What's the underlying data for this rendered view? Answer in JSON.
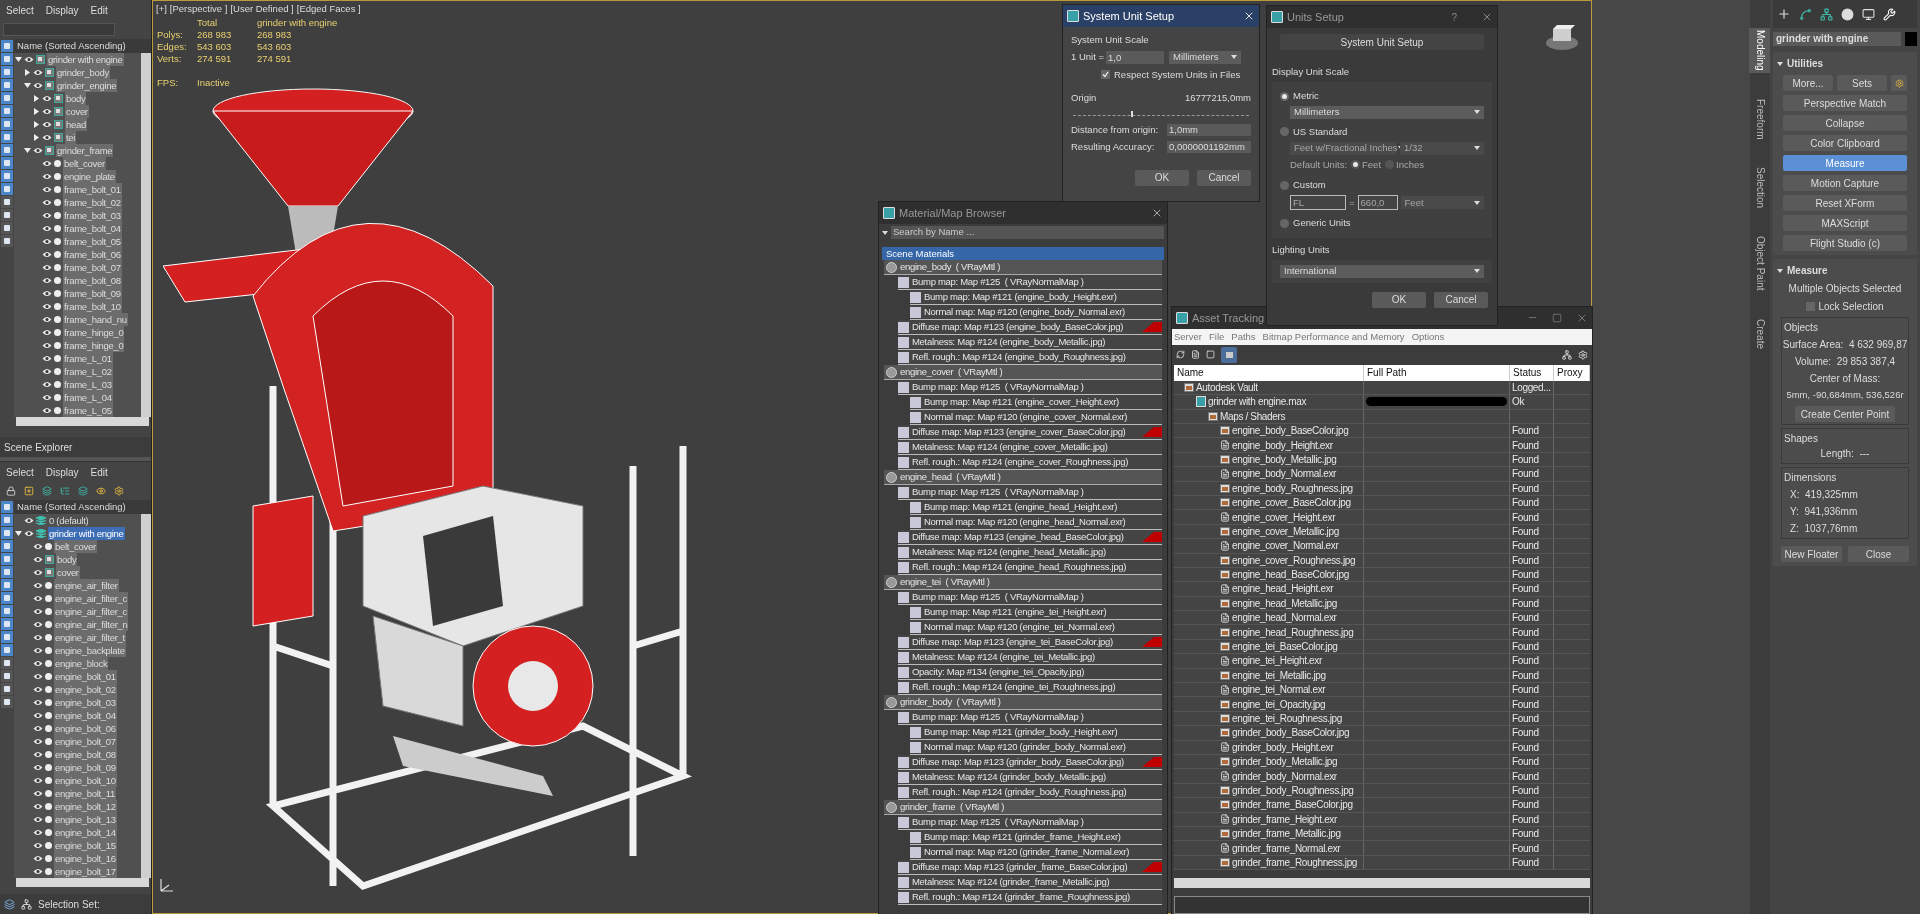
{
  "explorer_top": {
    "menu": [
      "Select",
      "Display",
      "Edit"
    ],
    "column": "Name (Sorted Ascending)",
    "footer": "Scene Explorer",
    "tree": [
      {
        "name": "grinder with engine",
        "kind": "group",
        "expanded": true,
        "children": [
          {
            "name": "grinder_body",
            "kind": "group",
            "expanded": false
          },
          {
            "name": "grinder_engine",
            "kind": "group",
            "expanded": true,
            "children": [
              {
                "name": "body",
                "kind": "group",
                "expanded": false
              },
              {
                "name": "cover",
                "kind": "group",
                "expanded": false
              },
              {
                "name": "head",
                "kind": "group",
                "expanded": false
              },
              {
                "name": "tei",
                "kind": "group",
                "expanded": false
              }
            ]
          },
          {
            "name": "grinder_frame",
            "kind": "group",
            "expanded": true,
            "children": [
              {
                "name": "belt_cover",
                "kind": "object"
              },
              {
                "name": "engine_plate",
                "kind": "object"
              },
              {
                "name": "frame_bolt_01",
                "kind": "object"
              },
              {
                "name": "frame_bolt_02",
                "kind": "object"
              },
              {
                "name": "frame_bolt_03",
                "kind": "object"
              },
              {
                "name": "frame_bolt_04",
                "kind": "object"
              },
              {
                "name": "frame_bolt_05",
                "kind": "object"
              },
              {
                "name": "frame_bolt_06",
                "kind": "object"
              },
              {
                "name": "frame_bolt_07",
                "kind": "object"
              },
              {
                "name": "frame_bolt_08",
                "kind": "object"
              },
              {
                "name": "frame_bolt_09",
                "kind": "object"
              },
              {
                "name": "frame_bolt_10",
                "kind": "object"
              },
              {
                "name": "frame_hand_nu",
                "kind": "object"
              },
              {
                "name": "frame_hinge_0",
                "kind": "object"
              },
              {
                "name": "frame_hinge_0",
                "kind": "object"
              },
              {
                "name": "frame_L_01",
                "kind": "object"
              },
              {
                "name": "frame_L_02",
                "kind": "object"
              },
              {
                "name": "frame_L_03",
                "kind": "object"
              },
              {
                "name": "frame_L_04",
                "kind": "object"
              },
              {
                "name": "frame_L_05",
                "kind": "object"
              }
            ]
          }
        ]
      }
    ]
  },
  "explorer_bottom": {
    "menu": [
      "Select",
      "Display",
      "Edit"
    ],
    "column": "Name (Sorted Ascending)",
    "footer": "Selection Set:",
    "tree": [
      {
        "name": "0 (default)",
        "kind": "layer",
        "selected": false
      },
      {
        "name": "grinder with engine",
        "kind": "layer",
        "expanded": true,
        "selected": true,
        "children": [
          {
            "name": "belt_cover",
            "kind": "object"
          },
          {
            "name": "body",
            "kind": "group"
          },
          {
            "name": "cover",
            "kind": "group"
          },
          {
            "name": "engine_air_filter",
            "kind": "object"
          },
          {
            "name": "engine_air_filter_c",
            "kind": "object"
          },
          {
            "name": "engine_air_filter_c",
            "kind": "object"
          },
          {
            "name": "engine_air_filter_n",
            "kind": "object"
          },
          {
            "name": "engine_air_filter_t",
            "kind": "object"
          },
          {
            "name": "engine_backplate",
            "kind": "object"
          },
          {
            "name": "engine_block",
            "kind": "object"
          },
          {
            "name": "engine_bolt_01",
            "kind": "object"
          },
          {
            "name": "engine_bolt_02",
            "kind": "object"
          },
          {
            "name": "engine_bolt_03",
            "kind": "object"
          },
          {
            "name": "engine_bolt_04",
            "kind": "object"
          },
          {
            "name": "engine_bolt_06",
            "kind": "object"
          },
          {
            "name": "engine_bolt_07",
            "kind": "object"
          },
          {
            "name": "engine_bolt_08",
            "kind": "object"
          },
          {
            "name": "engine_bolt_09",
            "kind": "object"
          },
          {
            "name": "engine_bolt_10",
            "kind": "object"
          },
          {
            "name": "engine_bolt_11",
            "kind": "object"
          },
          {
            "name": "engine_bolt_12",
            "kind": "object"
          },
          {
            "name": "engine_bolt_13",
            "kind": "object"
          },
          {
            "name": "engine_bolt_14",
            "kind": "object"
          },
          {
            "name": "engine_bolt_15",
            "kind": "object"
          },
          {
            "name": "engine_bolt_16",
            "kind": "object"
          },
          {
            "name": "engine_bolt_17",
            "kind": "object"
          }
        ]
      }
    ]
  },
  "viewport": {
    "labels": [
      "[+]",
      "[Perspective ]",
      "[User Defined ]",
      "[Edged Faces ]"
    ],
    "stats": {
      "headers": [
        "Total",
        "grinder with engine"
      ],
      "rows": [
        {
          "label": "Polys:",
          "values": [
            "268 983",
            "268 983"
          ]
        },
        {
          "label": "Edges:",
          "values": [
            "543 603",
            "543 603"
          ]
        },
        {
          "label": "Verts:",
          "values": [
            "274 591",
            "274 591"
          ]
        }
      ]
    },
    "fps": {
      "label": "FPS:",
      "value": "Inactive"
    }
  },
  "system_unit_setup": {
    "title": "System Unit Setup",
    "scale_heading": "System Unit Scale",
    "unit_label": "1 Unit =",
    "unit_value": "1,0",
    "unit": "Millimeters",
    "respect": {
      "label": "Respect System Units in Files",
      "checked": true
    },
    "origin_label": "Origin",
    "origin_value": "16777215,0mm",
    "origin": {
      "level": 0.33
    },
    "distance_label": "Distance from origin:",
    "distance": "1,0mm",
    "accuracy_label": "Resulting Accuracy:",
    "accuracy": "0,0000001192mm",
    "buttons": [
      "OK",
      "Cancel"
    ]
  },
  "units_setup": {
    "title": "Units Setup",
    "help": "?",
    "system_button": "System Unit Setup",
    "display_heading": "Display Unit Scale",
    "options": [
      {
        "kind": "metric",
        "label": "Metric",
        "selected": true,
        "dropdown": "Millimeters"
      },
      {
        "kind": "us",
        "label": "US Standard",
        "selected": false,
        "dropdowns": [
          "Feet w/Fractional Inches",
          "1/32"
        ],
        "default_label": "Default Units:",
        "defaults": [
          {
            "label": "Feet",
            "selected": true
          },
          {
            "label": "Inches",
            "selected": false
          }
        ]
      },
      {
        "kind": "custom",
        "label": "Custom",
        "selected": false,
        "field": "FL",
        "equals": "=",
        "value": "660,0",
        "unit": "Feet"
      },
      {
        "kind": "generic",
        "label": "Generic Units",
        "selected": false
      }
    ],
    "lighting_heading": "Lighting Units",
    "lighting": "International",
    "buttons": [
      "OK",
      "Cancel"
    ]
  },
  "material_browser": {
    "title": "Material/Map Browser",
    "search_placeholder": "Search by Name ...",
    "group": "Scene Materials",
    "materials": [
      {
        "label": "engine_body  ( VRayMtl )",
        "maps": [
          {
            "label": "Bump map: Map #125  ( VRayNormalMap )",
            "flag": false,
            "children": [
              {
                "label": "Bump map: Map #121 (engine_body_Height.exr)"
              },
              {
                "label": "Normal map: Map #120 (engine_body_Normal.exr)"
              }
            ]
          },
          {
            "label": "Diffuse map: Map #123 (engine_body_BaseColor.jpg)",
            "flag": true
          },
          {
            "label": "Metalness: Map #124 (engine_body_Metallic.jpg)",
            "flag": false
          },
          {
            "label": "Refl. rough.: Map #124 (engine_body_Roughness.jpg)",
            "flag": false
          }
        ]
      },
      {
        "label": "engine_cover  ( VRayMtl )",
        "maps": [
          {
            "label": "Bump map: Map #125  ( VRayNormalMap )",
            "flag": false,
            "children": [
              {
                "label": "Bump map: Map #121 (engine_cover_Height.exr)"
              },
              {
                "label": "Normal map: Map #120 (engine_cover_Normal.exr)"
              }
            ]
          },
          {
            "label": "Diffuse map: Map #123 (engine_cover_BaseColor.jpg)",
            "flag": true
          },
          {
            "label": "Metalness: Map #124 (engine_cover_Metallic.jpg)",
            "flag": false
          },
          {
            "label": "Refl. rough.: Map #124 (engine_cover_Roughness.jpg)",
            "flag": false
          }
        ]
      },
      {
        "label": "engine_head  ( VRayMtl )",
        "maps": [
          {
            "label": "Bump map: Map #125  ( VRayNormalMap )",
            "flag": false,
            "children": [
              {
                "label": "Bump map: Map #121 (engine_head_Height.exr)"
              },
              {
                "label": "Normal map: Map #120 (engine_head_Normal.exr)"
              }
            ]
          },
          {
            "label": "Diffuse map: Map #123 (engine_head_BaseColor.jpg)",
            "flag": true
          },
          {
            "label": "Metalness: Map #124 (engine_head_Metallic.jpg)",
            "flag": false
          },
          {
            "label": "Refl. rough.: Map #124 (engine_head_Roughness.jpg)",
            "flag": false
          }
        ]
      },
      {
        "label": "engine_tei  ( VRayMtl )",
        "maps": [
          {
            "label": "Bump map: Map #125  ( VRayNormalMap )",
            "flag": false,
            "children": [
              {
                "label": "Bump map: Map #121 (engine_tei_Height.exr)"
              },
              {
                "label": "Normal map: Map #120 (engine_tei_Normal.exr)"
              }
            ]
          },
          {
            "label": "Diffuse map: Map #123 (engine_tei_BaseColor.jpg)",
            "flag": true
          },
          {
            "label": "Metalness: Map #124 (engine_tei_Metallic.jpg)",
            "flag": false
          },
          {
            "label": "Opacity: Map #134 (engine_tei_Opacity.jpg)",
            "flag": false
          },
          {
            "label": "Refl. rough.: Map #124 (engine_tei_Roughness.jpg)",
            "flag": false
          }
        ]
      },
      {
        "label": "grinder_body  ( VRayMtl )",
        "maps": [
          {
            "label": "Bump map: Map #125  ( VRayNormalMap )",
            "flag": false,
            "children": [
              {
                "label": "Bump map: Map #121 (grinder_body_Height.exr)"
              },
              {
                "label": "Normal map: Map #120 (grinder_body_Normal.exr)"
              }
            ]
          },
          {
            "label": "Diffuse map: Map #123 (grinder_body_BaseColor.jpg)",
            "flag": true
          },
          {
            "label": "Metalness: Map #124 (grinder_body_Metallic.jpg)",
            "flag": false
          },
          {
            "label": "Refl. rough.: Map #124 (grinder_body_Roughness.jpg)",
            "flag": false
          }
        ]
      },
      {
        "label": "grinder_frame  ( VRayMtl )",
        "maps": [
          {
            "label": "Bump map: Map #125  ( VRayNormalMap )",
            "flag": false,
            "children": [
              {
                "label": "Bump map: Map #121 (grinder_frame_Height.exr)"
              },
              {
                "label": "Normal map: Map #120 (grinder_frame_Normal.exr)"
              }
            ]
          },
          {
            "label": "Diffuse map: Map #123 (grinder_frame_BaseColor.jpg)",
            "flag": true
          },
          {
            "label": "Metalness: Map #124 (grinder_frame_Metallic.jpg)",
            "flag": false
          },
          {
            "label": "Refl. rough.: Map #124 (grinder_frame_Roughness.jpg)",
            "flag": false
          }
        ]
      }
    ]
  },
  "asset_tracking": {
    "title": "Asset Tracking",
    "menu": [
      "Server",
      "File",
      "Paths",
      "Bitmap Performance and Memory",
      "Options"
    ],
    "columns": [
      "Name",
      "Full Path",
      "Status",
      "Proxy"
    ],
    "rows": [
      {
        "name": "Autodesk Vault",
        "kind": "folder",
        "status": "Logged...",
        "children": [
          {
            "name": "grinder with engine.max",
            "kind": "max",
            "status": "Ok",
            "redacted": true,
            "children": [
              {
                "name": "Maps / Shaders",
                "kind": "folder",
                "children": [
                  {
                    "name": "engine_body_BaseColor.jpg",
                    "kind": "image",
                    "status": "Found"
                  },
                  {
                    "name": "engine_body_Height.exr",
                    "kind": "exr",
                    "status": "Found"
                  },
                  {
                    "name": "engine_body_Metallic.jpg",
                    "kind": "image",
                    "status": "Found"
                  },
                  {
                    "name": "engine_body_Normal.exr",
                    "kind": "exr",
                    "status": "Found"
                  },
                  {
                    "name": "engine_body_Roughness.jpg",
                    "kind": "image",
                    "status": "Found"
                  },
                  {
                    "name": "engine_cover_BaseColor.jpg",
                    "kind": "image",
                    "status": "Found"
                  },
                  {
                    "name": "engine_cover_Height.exr",
                    "kind": "exr",
                    "status": "Found"
                  },
                  {
                    "name": "engine_cover_Metallic.jpg",
                    "kind": "image",
                    "status": "Found"
                  },
                  {
                    "name": "engine_cover_Normal.exr",
                    "kind": "exr",
                    "status": "Found"
                  },
                  {
                    "name": "engine_cover_Roughness.jpg",
                    "kind": "image",
                    "status": "Found"
                  },
                  {
                    "name": "engine_head_BaseColor.jpg",
                    "kind": "image",
                    "status": "Found"
                  },
                  {
                    "name": "engine_head_Height.exr",
                    "kind": "exr",
                    "status": "Found"
                  },
                  {
                    "name": "engine_head_Metallic.jpg",
                    "kind": "image",
                    "status": "Found"
                  },
                  {
                    "name": "engine_head_Normal.exr",
                    "kind": "exr",
                    "status": "Found"
                  },
                  {
                    "name": "engine_head_Roughness.jpg",
                    "kind": "image",
                    "status": "Found"
                  },
                  {
                    "name": "engine_tei_BaseColor.jpg",
                    "kind": "image",
                    "status": "Found"
                  },
                  {
                    "name": "engine_tei_Height.exr",
                    "kind": "exr",
                    "status": "Found"
                  },
                  {
                    "name": "engine_tei_Metallic.jpg",
                    "kind": "image",
                    "status": "Found"
                  },
                  {
                    "name": "engine_tei_Normal.exr",
                    "kind": "exr",
                    "status": "Found"
                  },
                  {
                    "name": "engine_tei_Opacity.jpg",
                    "kind": "image",
                    "status": "Found"
                  },
                  {
                    "name": "engine_tei_Roughness.jpg",
                    "kind": "image",
                    "status": "Found"
                  },
                  {
                    "name": "grinder_body_BaseColor.jpg",
                    "kind": "image",
                    "status": "Found"
                  },
                  {
                    "name": "grinder_body_Height.exr",
                    "kind": "exr",
                    "status": "Found"
                  },
                  {
                    "name": "grinder_body_Metallic.jpg",
                    "kind": "image",
                    "status": "Found"
                  },
                  {
                    "name": "grinder_body_Normal.exr",
                    "kind": "exr",
                    "status": "Found"
                  },
                  {
                    "name": "grinder_body_Roughness.jpg",
                    "kind": "image",
                    "status": "Found"
                  },
                  {
                    "name": "grinder_frame_BaseColor.jpg",
                    "kind": "image",
                    "status": "Found"
                  },
                  {
                    "name": "grinder_frame_Height.exr",
                    "kind": "exr",
                    "status": "Found"
                  },
                  {
                    "name": "grinder_frame_Metallic.jpg",
                    "kind": "image",
                    "status": "Found"
                  },
                  {
                    "name": "grinder_frame_Normal.exr",
                    "kind": "exr",
                    "status": "Found"
                  },
                  {
                    "name": "grinder_frame_Roughness.jpg",
                    "kind": "image",
                    "status": "Found"
                  }
                ]
              }
            ]
          }
        ]
      }
    ]
  },
  "side_tabs": [
    {
      "label": "Modeling",
      "selected": true
    },
    {
      "label": "Freeform",
      "selected": false
    },
    {
      "label": "Selection",
      "selected": false
    },
    {
      "label": "Object Paint",
      "selected": false
    },
    {
      "label": "Create",
      "selected": false
    }
  ],
  "command_panel": {
    "object_name": "grinder with engine",
    "utilities": {
      "title": "Utilities",
      "top_buttons": [
        "More...",
        "Sets"
      ],
      "buttons": [
        {
          "label": "Perspective Match",
          "selected": false
        },
        {
          "label": "Collapse",
          "selected": false
        },
        {
          "label": "Color Clipboard",
          "selected": false
        },
        {
          "label": "Measure",
          "selected": true
        },
        {
          "label": "Motion Capture",
          "selected": false
        },
        {
          "label": "Reset XForm",
          "selected": false
        },
        {
          "label": "MAXScript",
          "selected": false
        },
        {
          "label": "Flight Studio (c)",
          "selected": false
        }
      ]
    },
    "measure": {
      "title": "Measure",
      "status": "Multiple Objects Selected",
      "lock": {
        "label": "Lock Selection",
        "checked": false
      },
      "objects_heading": "Objects",
      "surface": "Surface Area:  4 632 969,87",
      "volume": "Volume:  29 853 387,4",
      "com_label": "Center of Mass:",
      "com": "5mm, -90,684mm, 536,526r",
      "center_button": "Create Center Point",
      "shapes_heading": "Shapes",
      "length": "Length:  ---",
      "dims_heading": "Dimensions",
      "dims": [
        "X:  419,325mm",
        "Y:  941,936mm",
        "Z:  1037,76mm"
      ],
      "buttons": [
        "New Floater",
        "Close"
      ]
    }
  }
}
